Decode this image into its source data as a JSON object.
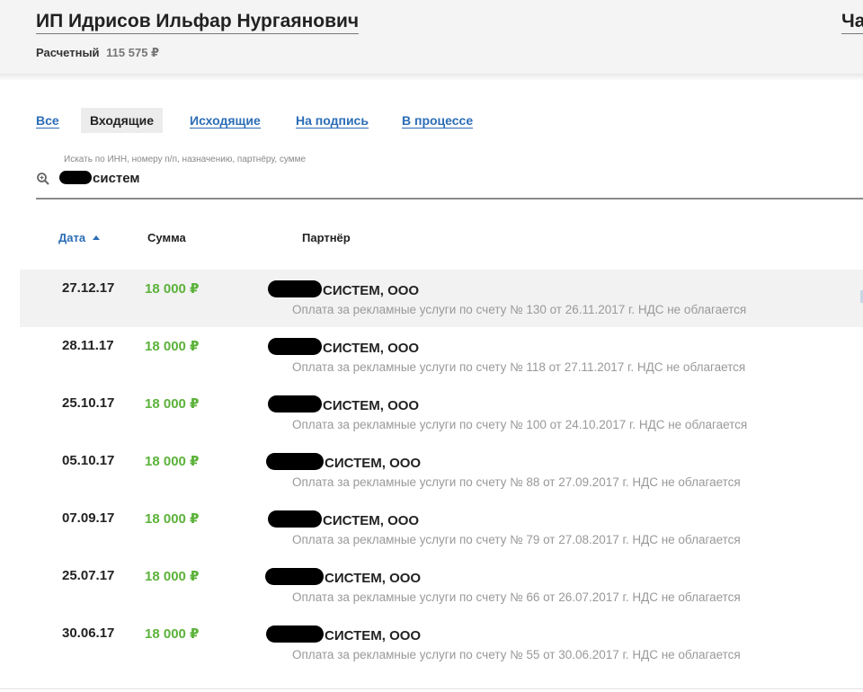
{
  "header": {
    "account_name": "ИП Идрисов Ильфар Нургаянович",
    "right_link": "Ча",
    "balance_label": "Расчетный",
    "balance_value": "115 575 ₽"
  },
  "tabs": [
    {
      "label": "Все",
      "active": false
    },
    {
      "label": "Входящие",
      "active": true
    },
    {
      "label": "Исходящие",
      "active": false
    },
    {
      "label": "На подпись",
      "active": false
    },
    {
      "label": "В процессе",
      "active": false
    }
  ],
  "search": {
    "hint": "Искать по ИНН, номеру п/п, назначению, партнёру, сумме",
    "value": "систем"
  },
  "table": {
    "headers": {
      "date": "Дата",
      "sum": "Сумма",
      "partner": "Партнёр"
    },
    "rows": [
      {
        "date": "27.12.17",
        "sum": "18 000 ₽",
        "partner": "СИСТЕМ, ООО",
        "description": "Оплата за рекламные услуги по счету № 130 от 26.11.2017 г. НДС не облагается"
      },
      {
        "date": "28.11.17",
        "sum": "18 000 ₽",
        "partner": "СИСТЕМ, ООО",
        "description": "Оплата за рекламные услуги по счету № 118 от 27.11.2017 г. НДС не облагается"
      },
      {
        "date": "25.10.17",
        "sum": "18 000 ₽",
        "partner": "СИСТЕМ, ООО",
        "description": "Оплата за рекламные услуги по счету № 100 от 24.10.2017 г. НДС не облагается"
      },
      {
        "date": "05.10.17",
        "sum": "18 000 ₽",
        "partner": "СИСТЕМ, ООО",
        "description": "Оплата за рекламные услуги по счету № 88 от 27.09.2017 г. НДС не облагается"
      },
      {
        "date": "07.09.17",
        "sum": "18 000 ₽",
        "partner": "СИСТЕМ, ООО",
        "description": "Оплата за рекламные услуги по счету № 79 от 27.08.2017 г. НДС не облагается"
      },
      {
        "date": "25.07.17",
        "sum": "18 000 ₽",
        "partner": "СИСТЕМ, ООО",
        "description": "Оплата за рекламные услуги по счету № 66 от 26.07.2017 г. НДС не облагается"
      },
      {
        "date": "30.06.17",
        "sum": "18 000 ₽",
        "partner": "СИСТЕМ, ООО",
        "description": "Оплата за рекламные услуги по счету № 55 от 30.06.2017 г. НДС не облагается"
      }
    ]
  },
  "colors": {
    "link": "#2c6db6",
    "amount": "#5cb23a",
    "muted": "#999999",
    "header_bg": "#f4f4f4"
  }
}
